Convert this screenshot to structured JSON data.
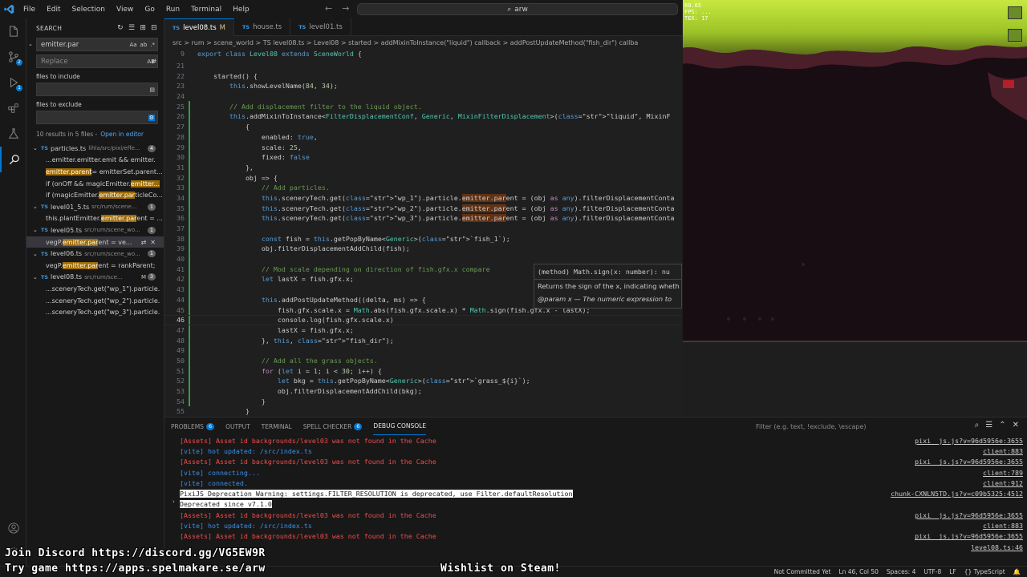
{
  "menu": [
    "File",
    "Edit",
    "Selection",
    "View",
    "Go",
    "Run",
    "Terminal",
    "Help"
  ],
  "command_center": "arw",
  "search": {
    "header": "SEARCH",
    "query": "emitter.par",
    "replace_placeholder": "Replace",
    "include_label": "files to include",
    "exclude_label": "files to exclude",
    "results_summary": "10 results in 5 files -",
    "open_in_editor": "Open in editor",
    "files": [
      {
        "name": "particles.ts",
        "dir": "lihla/src/pixi/effe...",
        "count": "4",
        "matches": [
          {
            "pre": "...emitter.emitter.emit && emitter.",
            "hit": "",
            "post": ""
          },
          {
            "pre": "",
            "hit": "emitter.parent",
            "post": " = emitterSet.parent..."
          },
          {
            "pre": "if (onOff && magicEmitter.",
            "hit": "emitter...",
            "post": ""
          },
          {
            "pre": "if (magicEmitter.",
            "hit": "emitter.par",
            "post": "ticleCo..."
          }
        ]
      },
      {
        "name": "level01_5.ts",
        "dir": "src/rum/scene...",
        "count": "1",
        "matches": [
          {
            "pre": "this.plantEmitter.",
            "hit": "emitter.par",
            "post": "ent = ..."
          }
        ]
      },
      {
        "name": "level05.ts",
        "dir": "src/rum/scene_wo...",
        "count": "1",
        "matches": [
          {
            "pre": "vegP.",
            "hit": "emitter.par",
            "post": "ent = ve..."
          }
        ]
      },
      {
        "name": "level06.ts",
        "dir": "src/rum/scene_wo...",
        "count": "1",
        "matches": [
          {
            "pre": "vegP.",
            "hit": "emitter.par",
            "post": "ent = rankParent;"
          }
        ]
      },
      {
        "name": "level08.ts",
        "dir": "src/rum/sce...",
        "count": "3",
        "modified": "M",
        "matches": [
          {
            "pre": "...sceneryTech.get(\"wp_1\").particle.",
            "hit": "",
            "post": ""
          },
          {
            "pre": "...sceneryTech.get(\"wp_2\").particle.",
            "hit": "",
            "post": ""
          },
          {
            "pre": "...sceneryTech.get(\"wp_3\").particle.",
            "hit": "",
            "post": ""
          }
        ]
      }
    ]
  },
  "tabs": [
    {
      "label": "level08.ts",
      "modified": "M",
      "active": true
    },
    {
      "label": "house.ts",
      "modified": "",
      "active": false
    },
    {
      "label": "level01.ts",
      "modified": "",
      "active": false
    }
  ],
  "breadcrumb": "src > rum > scene_world > TS level08.ts > Level08 > started > addMixinToInstance(\"liquid\") callback > addPostUpdateMethod(\"fish_dir\") callba",
  "code_lines": [
    {
      "n": "9",
      "text": "export class Level08 extends SceneWorld {"
    },
    {
      "n": "21",
      "text": ""
    },
    {
      "n": "22",
      "text": "    started() {"
    },
    {
      "n": "23",
      "text": "        this.showLevelName(84, 34);"
    },
    {
      "n": "24",
      "text": ""
    },
    {
      "n": "25",
      "text": "        // Add displacement filter to the liquid object."
    },
    {
      "n": "26",
      "text": "        this.addMixinToInstance<FilterDisplacementConf, Generic, MixinFilterDisplacement>(\"liquid\", MixinF"
    },
    {
      "n": "27",
      "text": "            {"
    },
    {
      "n": "28",
      "text": "                enabled: true,"
    },
    {
      "n": "29",
      "text": "                scale: 25,"
    },
    {
      "n": "30",
      "text": "                fixed: false"
    },
    {
      "n": "31",
      "text": "            },"
    },
    {
      "n": "32",
      "text": "            obj => {"
    },
    {
      "n": "33",
      "text": "                // Add particles."
    },
    {
      "n": "34",
      "text": "                this.sceneryTech.get(\"wp_1\").particle.emitter.parent = (obj as any).filterDisplacementConta"
    },
    {
      "n": "35",
      "text": "                this.sceneryTech.get(\"wp_2\").particle.emitter.parent = (obj as any).filterDisplacementConta"
    },
    {
      "n": "36",
      "text": "                this.sceneryTech.get(\"wp_3\").particle.emitter.parent = (obj as any).filterDisplacementConta"
    },
    {
      "n": "37",
      "text": ""
    },
    {
      "n": "38",
      "text": "                const fish = this.getPopByName<Generic>(`fish_1`);"
    },
    {
      "n": "39",
      "text": "                obj.filterDisplacementAddChild(fish);"
    },
    {
      "n": "40",
      "text": ""
    },
    {
      "n": "41",
      "text": "                // Mod scale depending on direction of fish.gfx.x compare"
    },
    {
      "n": "42",
      "text": "                let lastX = fish.gfx.x;"
    },
    {
      "n": "43",
      "text": ""
    },
    {
      "n": "44",
      "text": "                this.addPostUpdateMethod((delta, ms) => {"
    },
    {
      "n": "45",
      "text": "                    fish.gfx.scale.x = Math.abs(fish.gfx.scale.x) * Math.sign(fish.gfx.x - lastX);"
    },
    {
      "n": "46",
      "text": "                    console.log(fish.gfx.scale.x)"
    },
    {
      "n": "47",
      "text": "                    lastX = fish.gfx.x;"
    },
    {
      "n": "48",
      "text": "                }, this, \"fish_dir\");"
    },
    {
      "n": "49",
      "text": ""
    },
    {
      "n": "50",
      "text": "                // Add all the grass objects."
    },
    {
      "n": "51",
      "text": "                for (let i = 1; i < 30; i++) {"
    },
    {
      "n": "52",
      "text": "                    let bkg = this.getPopByName<Generic>(`grass_${i}`);"
    },
    {
      "n": "53",
      "text": "                    obj.filterDisplacementAddChild(bkg);"
    },
    {
      "n": "54",
      "text": "                }"
    },
    {
      "n": "55",
      "text": "            }"
    }
  ],
  "hover": {
    "signature": "(method) Math.sign(x: number): nu",
    "description": "Returns the sign of the x, indicating wheth",
    "param": "@param x — The numeric expression to"
  },
  "game": {
    "fps": "60.65",
    "fps_label": "FPS: ...",
    "line3": "TEX: 17"
  },
  "panel": {
    "tabs": [
      {
        "label": "PROBLEMS",
        "badge": "6"
      },
      {
        "label": "OUTPUT",
        "badge": ""
      },
      {
        "label": "TERMINAL",
        "badge": ""
      },
      {
        "label": "SPELL CHECKER",
        "badge": "6"
      },
      {
        "label": "DEBUG CONSOLE",
        "badge": "",
        "active": true
      }
    ],
    "filter_placeholder": "Filter (e.g. text, !exclude, \\escape)",
    "lines": [
      {
        "kind": "err",
        "text": "[Assets] Asset id backgrounds/level03 was not found in the Cache",
        "src": "pixi__js.js?v=96d5956e:3655"
      },
      {
        "kind": "info",
        "text": "[vite] hot updated: /src/index.ts",
        "src": "client:883"
      },
      {
        "kind": "err",
        "text": "[Assets] Asset id backgrounds/level03 was not found in the Cache",
        "src": "pixi__js.js?v=96d5956e:3655"
      },
      {
        "kind": "info",
        "text": "[vite] connecting...",
        "src": "client:789"
      },
      {
        "kind": "info",
        "text": "[vite] connected.",
        "src": "client:912"
      },
      {
        "kind": "warn",
        "text": "PixiJS Deprecation Warning: settings.FILTER_RESOLUTION is deprecated, use Filter.defaultResolution",
        "src": "chunk-CXNLN5TD.js?v=c09b5325:4512"
      },
      {
        "kind": "warn",
        "text": "Deprecated since v7.1.0",
        "src": ""
      },
      {
        "kind": "err",
        "text": "[Assets] Asset id backgrounds/level03 was not found in the Cache",
        "src": "pixi__js.js?v=96d5956e:3655"
      },
      {
        "kind": "info",
        "text": "[vite] hot updated: /src/index.ts",
        "src": "client:883"
      },
      {
        "kind": "err",
        "text": "[Assets] Asset id backgrounds/level03 was not found in the Cache",
        "src": "pixi__js.js?v=96d5956e:3655"
      },
      {
        "kind": "plain",
        "text": "",
        "src": "level08.ts:46"
      }
    ]
  },
  "overlay": {
    "discord": "Join Discord https://discord.gg/VG5EW9R",
    "try_game": "Try game https://apps.spelmakare.se/arw",
    "wishlist": "Wishlist on Steam!"
  },
  "status": {
    "commit": "Not Committed Yet",
    "position": "Ln 46, Col 50",
    "spaces": "Spaces: 4",
    "encoding": "UTF-8",
    "eol": "LF",
    "language": "{} TypeScript"
  },
  "colors": {
    "accent": "#0078d4",
    "match": "#613214",
    "error": "#f14c4c",
    "info": "#3b8eea"
  }
}
